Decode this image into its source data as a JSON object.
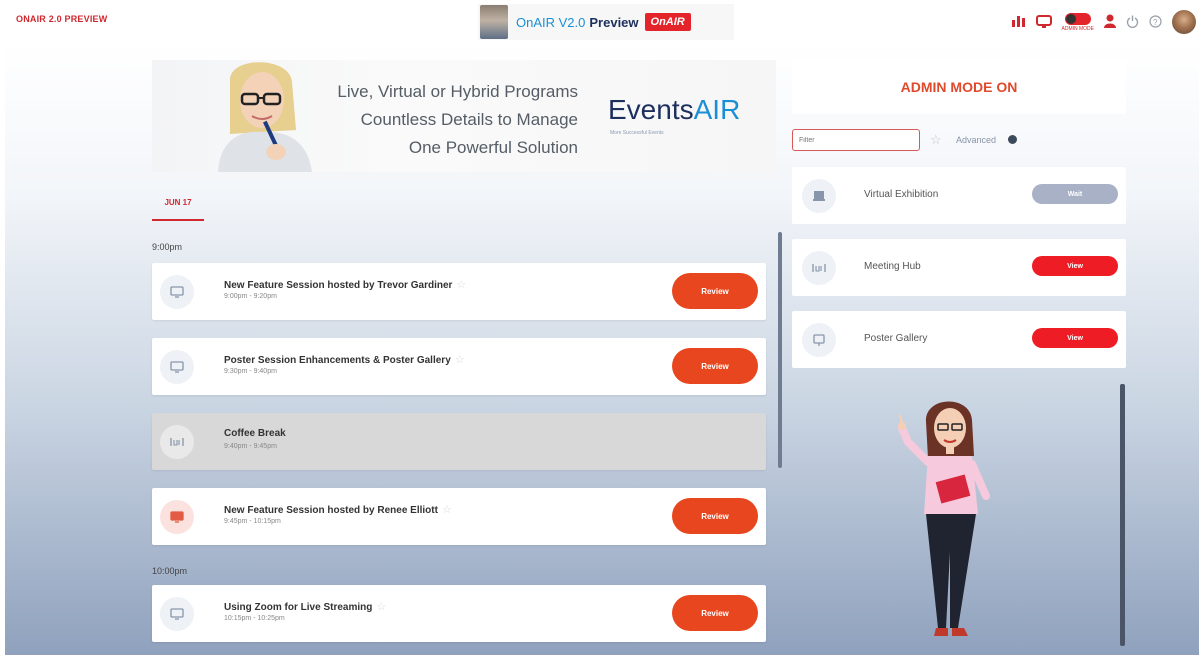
{
  "header": {
    "brand": "ONAIR 2.0 PREVIEW",
    "banner": {
      "title": "OnAIR V2.0",
      "title_bold": "Preview",
      "badge": "OnAIR"
    },
    "admin_toggle_label": "ADMIN MODE",
    "icons": [
      "leaderboard-icon",
      "chat-icon",
      "admin-toggle",
      "profile-icon",
      "logout-icon",
      "help-icon",
      "avatar"
    ]
  },
  "hero": {
    "lines": [
      "Live, Virtual or Hybrid Programs",
      "Countless Details to Manage",
      "One Powerful Solution"
    ],
    "logo_main": "Events",
    "logo_accent": "AIR",
    "logo_sub": "More Successful Events"
  },
  "agenda": {
    "date_tab": "JUN 17",
    "time_groups": [
      {
        "label": "9:00pm"
      },
      {
        "label": "10:00pm"
      }
    ],
    "sessions": [
      {
        "title": "New Feature Session hosted by Trevor Gardiner",
        "time": "9:00pm - 9:20pm",
        "button": "Review",
        "icon": "monitor-icon"
      },
      {
        "title": "Poster Session Enhancements & Poster Gallery",
        "time": "9:30pm - 9:40pm",
        "button": "Review",
        "icon": "monitor-icon"
      },
      {
        "title": "Coffee Break",
        "time": "9:40pm - 9:45pm",
        "button": "",
        "icon": "break-icon"
      },
      {
        "title": "New Feature Session hosted by Renee Elliott",
        "time": "9:45pm - 10:15pm",
        "button": "Review",
        "icon": "monitor-icon"
      },
      {
        "title": "Using Zoom for Live Streaming",
        "time": "10:15pm - 10:25pm",
        "button": "Review",
        "icon": "monitor-icon"
      }
    ]
  },
  "sidebar": {
    "admin_mode": "ADMIN MODE ON",
    "filter_placeholder": "Filter",
    "advanced_label": "Advanced",
    "features": [
      {
        "label": "Virtual Exhibition",
        "button": "Wait",
        "state": "wait",
        "icon": "exhibition-icon"
      },
      {
        "label": "Meeting Hub",
        "button": "View",
        "state": "view",
        "icon": "meeting-icon"
      },
      {
        "label": "Poster Gallery",
        "button": "View",
        "state": "view",
        "icon": "poster-icon"
      }
    ]
  },
  "colors": {
    "accent_red": "#d0282f",
    "review_orange": "#e8461e",
    "view_red": "#ee1c24",
    "wait_grey": "#a9b1c6"
  }
}
